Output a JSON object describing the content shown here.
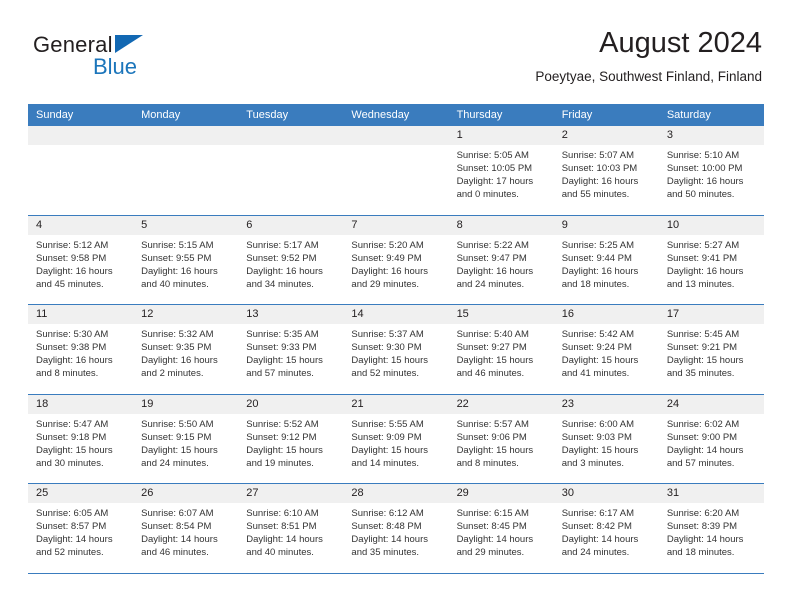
{
  "logo": {
    "word_one": "General",
    "word_two": "Blue",
    "triangle_color": "#1268b3",
    "blue_color": "#1b75bb"
  },
  "header": {
    "title": "August 2024",
    "subtitle": "Poeytyae, Southwest Finland, Finland"
  },
  "theme": {
    "header_blue": "#3a7cbe",
    "day_band_gray": "#f0f0f0",
    "text_color": "#231f20"
  },
  "weekdays": [
    "Sunday",
    "Monday",
    "Tuesday",
    "Wednesday",
    "Thursday",
    "Friday",
    "Saturday"
  ],
  "weeks": [
    [
      {
        "day": "",
        "sunrise": "",
        "sunset": "",
        "daylight1": "",
        "daylight2": ""
      },
      {
        "day": "",
        "sunrise": "",
        "sunset": "",
        "daylight1": "",
        "daylight2": ""
      },
      {
        "day": "",
        "sunrise": "",
        "sunset": "",
        "daylight1": "",
        "daylight2": ""
      },
      {
        "day": "",
        "sunrise": "",
        "sunset": "",
        "daylight1": "",
        "daylight2": ""
      },
      {
        "day": "1",
        "sunrise": "Sunrise: 5:05 AM",
        "sunset": "Sunset: 10:05 PM",
        "daylight1": "Daylight: 17 hours",
        "daylight2": "and 0 minutes."
      },
      {
        "day": "2",
        "sunrise": "Sunrise: 5:07 AM",
        "sunset": "Sunset: 10:03 PM",
        "daylight1": "Daylight: 16 hours",
        "daylight2": "and 55 minutes."
      },
      {
        "day": "3",
        "sunrise": "Sunrise: 5:10 AM",
        "sunset": "Sunset: 10:00 PM",
        "daylight1": "Daylight: 16 hours",
        "daylight2": "and 50 minutes."
      }
    ],
    [
      {
        "day": "4",
        "sunrise": "Sunrise: 5:12 AM",
        "sunset": "Sunset: 9:58 PM",
        "daylight1": "Daylight: 16 hours",
        "daylight2": "and 45 minutes."
      },
      {
        "day": "5",
        "sunrise": "Sunrise: 5:15 AM",
        "sunset": "Sunset: 9:55 PM",
        "daylight1": "Daylight: 16 hours",
        "daylight2": "and 40 minutes."
      },
      {
        "day": "6",
        "sunrise": "Sunrise: 5:17 AM",
        "sunset": "Sunset: 9:52 PM",
        "daylight1": "Daylight: 16 hours",
        "daylight2": "and 34 minutes."
      },
      {
        "day": "7",
        "sunrise": "Sunrise: 5:20 AM",
        "sunset": "Sunset: 9:49 PM",
        "daylight1": "Daylight: 16 hours",
        "daylight2": "and 29 minutes."
      },
      {
        "day": "8",
        "sunrise": "Sunrise: 5:22 AM",
        "sunset": "Sunset: 9:47 PM",
        "daylight1": "Daylight: 16 hours",
        "daylight2": "and 24 minutes."
      },
      {
        "day": "9",
        "sunrise": "Sunrise: 5:25 AM",
        "sunset": "Sunset: 9:44 PM",
        "daylight1": "Daylight: 16 hours",
        "daylight2": "and 18 minutes."
      },
      {
        "day": "10",
        "sunrise": "Sunrise: 5:27 AM",
        "sunset": "Sunset: 9:41 PM",
        "daylight1": "Daylight: 16 hours",
        "daylight2": "and 13 minutes."
      }
    ],
    [
      {
        "day": "11",
        "sunrise": "Sunrise: 5:30 AM",
        "sunset": "Sunset: 9:38 PM",
        "daylight1": "Daylight: 16 hours",
        "daylight2": "and 8 minutes."
      },
      {
        "day": "12",
        "sunrise": "Sunrise: 5:32 AM",
        "sunset": "Sunset: 9:35 PM",
        "daylight1": "Daylight: 16 hours",
        "daylight2": "and 2 minutes."
      },
      {
        "day": "13",
        "sunrise": "Sunrise: 5:35 AM",
        "sunset": "Sunset: 9:33 PM",
        "daylight1": "Daylight: 15 hours",
        "daylight2": "and 57 minutes."
      },
      {
        "day": "14",
        "sunrise": "Sunrise: 5:37 AM",
        "sunset": "Sunset: 9:30 PM",
        "daylight1": "Daylight: 15 hours",
        "daylight2": "and 52 minutes."
      },
      {
        "day": "15",
        "sunrise": "Sunrise: 5:40 AM",
        "sunset": "Sunset: 9:27 PM",
        "daylight1": "Daylight: 15 hours",
        "daylight2": "and 46 minutes."
      },
      {
        "day": "16",
        "sunrise": "Sunrise: 5:42 AM",
        "sunset": "Sunset: 9:24 PM",
        "daylight1": "Daylight: 15 hours",
        "daylight2": "and 41 minutes."
      },
      {
        "day": "17",
        "sunrise": "Sunrise: 5:45 AM",
        "sunset": "Sunset: 9:21 PM",
        "daylight1": "Daylight: 15 hours",
        "daylight2": "and 35 minutes."
      }
    ],
    [
      {
        "day": "18",
        "sunrise": "Sunrise: 5:47 AM",
        "sunset": "Sunset: 9:18 PM",
        "daylight1": "Daylight: 15 hours",
        "daylight2": "and 30 minutes."
      },
      {
        "day": "19",
        "sunrise": "Sunrise: 5:50 AM",
        "sunset": "Sunset: 9:15 PM",
        "daylight1": "Daylight: 15 hours",
        "daylight2": "and 24 minutes."
      },
      {
        "day": "20",
        "sunrise": "Sunrise: 5:52 AM",
        "sunset": "Sunset: 9:12 PM",
        "daylight1": "Daylight: 15 hours",
        "daylight2": "and 19 minutes."
      },
      {
        "day": "21",
        "sunrise": "Sunrise: 5:55 AM",
        "sunset": "Sunset: 9:09 PM",
        "daylight1": "Daylight: 15 hours",
        "daylight2": "and 14 minutes."
      },
      {
        "day": "22",
        "sunrise": "Sunrise: 5:57 AM",
        "sunset": "Sunset: 9:06 PM",
        "daylight1": "Daylight: 15 hours",
        "daylight2": "and 8 minutes."
      },
      {
        "day": "23",
        "sunrise": "Sunrise: 6:00 AM",
        "sunset": "Sunset: 9:03 PM",
        "daylight1": "Daylight: 15 hours",
        "daylight2": "and 3 minutes."
      },
      {
        "day": "24",
        "sunrise": "Sunrise: 6:02 AM",
        "sunset": "Sunset: 9:00 PM",
        "daylight1": "Daylight: 14 hours",
        "daylight2": "and 57 minutes."
      }
    ],
    [
      {
        "day": "25",
        "sunrise": "Sunrise: 6:05 AM",
        "sunset": "Sunset: 8:57 PM",
        "daylight1": "Daylight: 14 hours",
        "daylight2": "and 52 minutes."
      },
      {
        "day": "26",
        "sunrise": "Sunrise: 6:07 AM",
        "sunset": "Sunset: 8:54 PM",
        "daylight1": "Daylight: 14 hours",
        "daylight2": "and 46 minutes."
      },
      {
        "day": "27",
        "sunrise": "Sunrise: 6:10 AM",
        "sunset": "Sunset: 8:51 PM",
        "daylight1": "Daylight: 14 hours",
        "daylight2": "and 40 minutes."
      },
      {
        "day": "28",
        "sunrise": "Sunrise: 6:12 AM",
        "sunset": "Sunset: 8:48 PM",
        "daylight1": "Daylight: 14 hours",
        "daylight2": "and 35 minutes."
      },
      {
        "day": "29",
        "sunrise": "Sunrise: 6:15 AM",
        "sunset": "Sunset: 8:45 PM",
        "daylight1": "Daylight: 14 hours",
        "daylight2": "and 29 minutes."
      },
      {
        "day": "30",
        "sunrise": "Sunrise: 6:17 AM",
        "sunset": "Sunset: 8:42 PM",
        "daylight1": "Daylight: 14 hours",
        "daylight2": "and 24 minutes."
      },
      {
        "day": "31",
        "sunrise": "Sunrise: 6:20 AM",
        "sunset": "Sunset: 8:39 PM",
        "daylight1": "Daylight: 14 hours",
        "daylight2": "and 18 minutes."
      }
    ]
  ]
}
